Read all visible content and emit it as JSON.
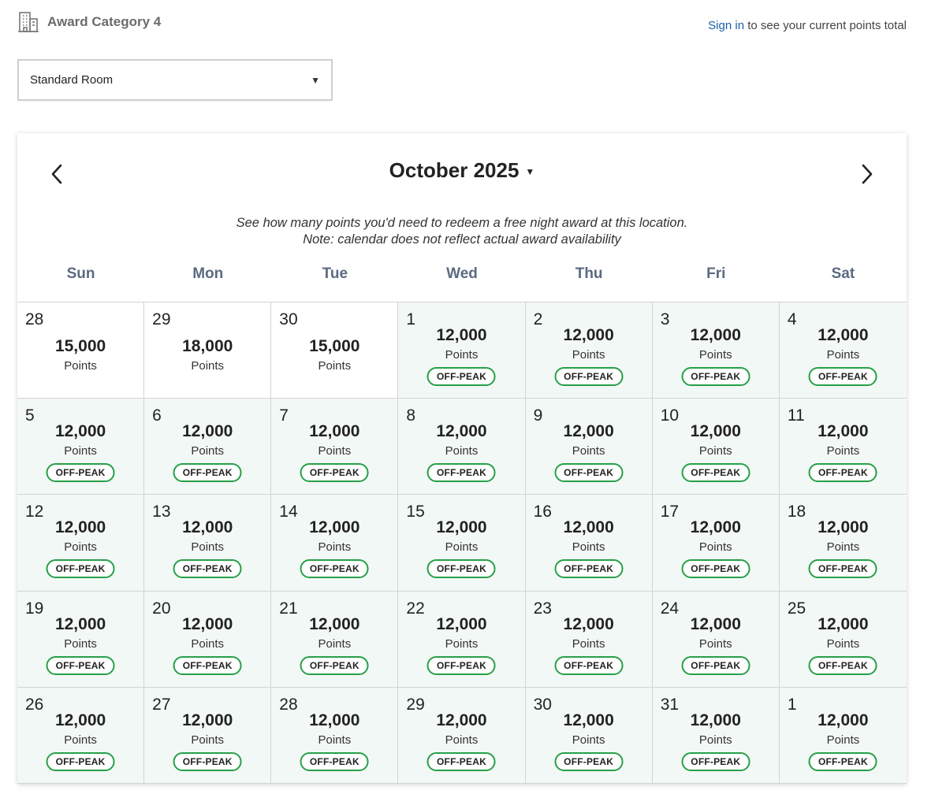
{
  "header": {
    "category_label": "Award Category 4",
    "category_icon": "building-icon",
    "signin_link": "Sign in",
    "signin_suffix": " to see your current points total"
  },
  "room_select": {
    "selected": "Standard Room"
  },
  "calendar": {
    "month_label": "October 2025",
    "note": "See how many points you'd need to redeem a free night award at this location. Note: calendar does not reflect actual award availability",
    "weekdays": [
      "Sun",
      "Mon",
      "Tue",
      "Wed",
      "Thu",
      "Fri",
      "Sat"
    ],
    "points_unit": "Points",
    "colors": {
      "off_peak_border": "#26a047",
      "available_bg": "#f2f8f5"
    },
    "days": [
      {
        "day": "28",
        "points": "15,000",
        "badge": "",
        "past": true
      },
      {
        "day": "29",
        "points": "18,000",
        "badge": "",
        "past": true
      },
      {
        "day": "30",
        "points": "15,000",
        "badge": "",
        "past": true
      },
      {
        "day": "1",
        "points": "12,000",
        "badge": "OFF-PEAK",
        "past": false
      },
      {
        "day": "2",
        "points": "12,000",
        "badge": "OFF-PEAK",
        "past": false
      },
      {
        "day": "3",
        "points": "12,000",
        "badge": "OFF-PEAK",
        "past": false
      },
      {
        "day": "4",
        "points": "12,000",
        "badge": "OFF-PEAK",
        "past": false
      },
      {
        "day": "5",
        "points": "12,000",
        "badge": "OFF-PEAK",
        "past": false
      },
      {
        "day": "6",
        "points": "12,000",
        "badge": "OFF-PEAK",
        "past": false
      },
      {
        "day": "7",
        "points": "12,000",
        "badge": "OFF-PEAK",
        "past": false
      },
      {
        "day": "8",
        "points": "12,000",
        "badge": "OFF-PEAK",
        "past": false
      },
      {
        "day": "9",
        "points": "12,000",
        "badge": "OFF-PEAK",
        "past": false
      },
      {
        "day": "10",
        "points": "12,000",
        "badge": "OFF-PEAK",
        "past": false
      },
      {
        "day": "11",
        "points": "12,000",
        "badge": "OFF-PEAK",
        "past": false
      },
      {
        "day": "12",
        "points": "12,000",
        "badge": "OFF-PEAK",
        "past": false
      },
      {
        "day": "13",
        "points": "12,000",
        "badge": "OFF-PEAK",
        "past": false
      },
      {
        "day": "14",
        "points": "12,000",
        "badge": "OFF-PEAK",
        "past": false
      },
      {
        "day": "15",
        "points": "12,000",
        "badge": "OFF-PEAK",
        "past": false
      },
      {
        "day": "16",
        "points": "12,000",
        "badge": "OFF-PEAK",
        "past": false
      },
      {
        "day": "17",
        "points": "12,000",
        "badge": "OFF-PEAK",
        "past": false
      },
      {
        "day": "18",
        "points": "12,000",
        "badge": "OFF-PEAK",
        "past": false
      },
      {
        "day": "19",
        "points": "12,000",
        "badge": "OFF-PEAK",
        "past": false
      },
      {
        "day": "20",
        "points": "12,000",
        "badge": "OFF-PEAK",
        "past": false
      },
      {
        "day": "21",
        "points": "12,000",
        "badge": "OFF-PEAK",
        "past": false
      },
      {
        "day": "22",
        "points": "12,000",
        "badge": "OFF-PEAK",
        "past": false
      },
      {
        "day": "23",
        "points": "12,000",
        "badge": "OFF-PEAK",
        "past": false
      },
      {
        "day": "24",
        "points": "12,000",
        "badge": "OFF-PEAK",
        "past": false
      },
      {
        "day": "25",
        "points": "12,000",
        "badge": "OFF-PEAK",
        "past": false
      },
      {
        "day": "26",
        "points": "12,000",
        "badge": "OFF-PEAK",
        "past": false
      },
      {
        "day": "27",
        "points": "12,000",
        "badge": "OFF-PEAK",
        "past": false
      },
      {
        "day": "28",
        "points": "12,000",
        "badge": "OFF-PEAK",
        "past": false
      },
      {
        "day": "29",
        "points": "12,000",
        "badge": "OFF-PEAK",
        "past": false
      },
      {
        "day": "30",
        "points": "12,000",
        "badge": "OFF-PEAK",
        "past": false
      },
      {
        "day": "31",
        "points": "12,000",
        "badge": "OFF-PEAK",
        "past": false
      },
      {
        "day": "1",
        "points": "12,000",
        "badge": "OFF-PEAK",
        "past": false
      }
    ]
  }
}
